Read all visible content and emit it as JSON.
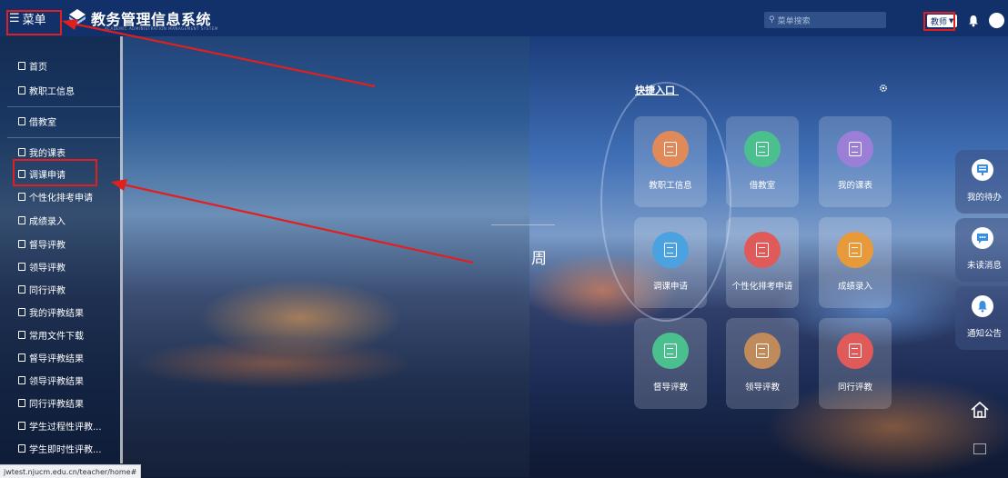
{
  "topbar": {
    "menu_label": "菜单",
    "system_title": "教务管理信息系统",
    "system_subtitle": "ACADEMIC ADMINISTRATION MANAGEMENT SYSTEM",
    "search_placeholder": "菜单搜索",
    "role_label": "教师"
  },
  "sidebar": {
    "items": [
      {
        "label": "首页"
      },
      {
        "label": "教职工信息"
      },
      {
        "label": "借教室"
      },
      {
        "label": "我的课表"
      },
      {
        "label": "调课申请"
      },
      {
        "label": "个性化排考申请"
      },
      {
        "label": "成绩录入"
      },
      {
        "label": "督导评教"
      },
      {
        "label": "领导评教"
      },
      {
        "label": "同行评教"
      },
      {
        "label": "我的评教结果"
      },
      {
        "label": "常用文件下载"
      },
      {
        "label": "督导评教结果"
      },
      {
        "label": "领导评教结果"
      },
      {
        "label": "同行评教结果"
      },
      {
        "label": "学生过程性评教..."
      },
      {
        "label": "学生即时性评教..."
      }
    ]
  },
  "main": {
    "week_text": "周",
    "quick_access_title": "快捷入口",
    "tiles": [
      {
        "label": "教职工信息",
        "color": "#e08a5a"
      },
      {
        "label": "借教室",
        "color": "#4bbf8e"
      },
      {
        "label": "我的课表",
        "color": "#9b7fd6"
      },
      {
        "label": "调课申请",
        "color": "#4aa3e0"
      },
      {
        "label": "个性化排考申请",
        "color": "#e05a5a"
      },
      {
        "label": "成绩录入",
        "color": "#e89a3a"
      },
      {
        "label": "督导评教",
        "color": "#4bbf8e"
      },
      {
        "label": "领导评教",
        "color": "#c08a5a"
      },
      {
        "label": "同行评教",
        "color": "#e05a5a"
      }
    ]
  },
  "right_panel": {
    "items": [
      {
        "label": "我的待办",
        "color": "#3a8ee0",
        "icon": "monitor-icon"
      },
      {
        "label": "未读消息",
        "color": "#3a8ee0",
        "icon": "message-icon"
      },
      {
        "label": "通知公告",
        "color": "#3a8ee0",
        "icon": "bell-icon"
      }
    ]
  },
  "status_bar": {
    "url": "jwtest.njucm.edu.cn/teacher/home#"
  }
}
